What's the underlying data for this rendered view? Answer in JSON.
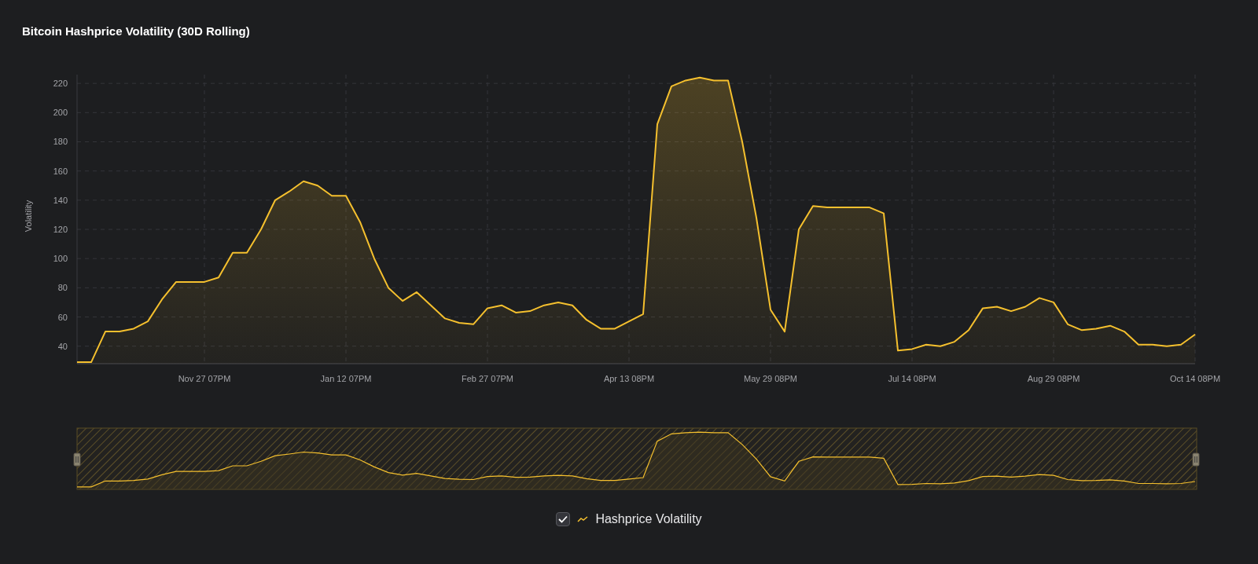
{
  "chart": {
    "chart_data": {
      "type": "area",
      "title": "Bitcoin Hashprice Volatility (30D Rolling)",
      "ylabel": "Volatility",
      "categories": [
        null,
        null,
        null,
        null,
        null,
        null,
        null,
        null,
        null,
        "Nov 27 07PM",
        null,
        null,
        null,
        null,
        null,
        null,
        null,
        null,
        null,
        "Jan 12 07PM",
        null,
        null,
        null,
        null,
        null,
        null,
        null,
        null,
        null,
        "Feb 27 07PM",
        null,
        null,
        null,
        null,
        null,
        null,
        null,
        null,
        null,
        "Apr 13 08PM",
        null,
        null,
        null,
        null,
        null,
        null,
        null,
        null,
        null,
        "May 29 08PM",
        null,
        null,
        null,
        null,
        null,
        null,
        null,
        null,
        null,
        "Jul 14 08PM",
        null,
        null,
        null,
        null,
        null,
        null,
        null,
        null,
        null,
        "Aug 29 08PM",
        null,
        null,
        null,
        null,
        null,
        null,
        null,
        null,
        null,
        "Oct 14 08PM"
      ],
      "series": [
        {
          "name": "Hashprice Volatility",
          "color": "#f5c02e",
          "values": [
            29,
            29,
            50,
            50,
            52,
            57,
            72,
            84,
            84,
            84,
            87,
            104,
            104,
            120,
            140,
            146,
            153,
            150,
            143,
            143,
            125,
            100,
            80,
            71,
            77,
            68,
            59,
            56,
            55,
            66,
            68,
            63,
            64,
            68,
            70,
            68,
            58,
            52,
            52,
            57,
            62,
            192,
            218,
            222,
            224,
            222,
            222,
            180,
            128,
            65,
            50,
            120,
            136,
            135,
            135,
            135,
            135,
            131,
            37,
            38,
            41,
            40,
            43,
            51,
            66,
            67,
            64,
            67,
            73,
            70,
            55,
            51,
            52,
            54,
            50,
            41,
            41,
            40,
            41,
            48
          ]
        }
      ],
      "ylim": [
        28,
        226
      ],
      "grid": true,
      "yticks": [
        40,
        60,
        80,
        100,
        120,
        140,
        160,
        180,
        200,
        220
      ]
    },
    "legend": {
      "checked": true
    }
  }
}
